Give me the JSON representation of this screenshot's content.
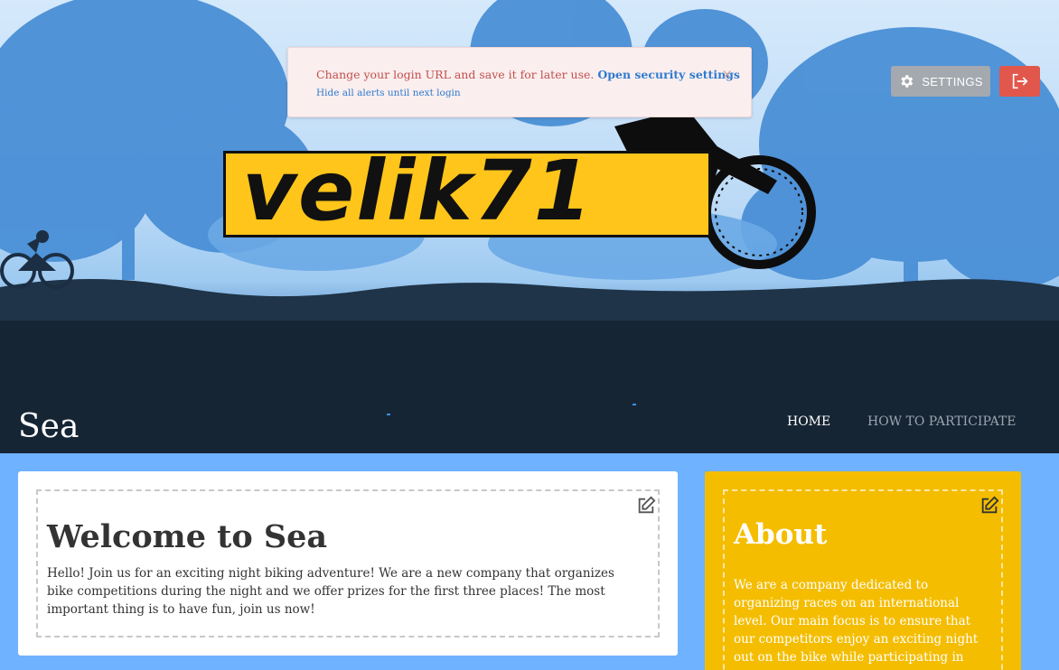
{
  "alert": {
    "message": "Change your login URL and save it for later use.",
    "link": "Open security settings",
    "hide": "Hide all alerts until next login",
    "close": "×"
  },
  "toolbar": {
    "settings_label": "SETTINGS"
  },
  "logo": {
    "text": "velik71"
  },
  "site": {
    "title": "Sea"
  },
  "nav": {
    "items": [
      {
        "label": "HOME"
      },
      {
        "label": "HOW TO PARTICIPATE"
      }
    ]
  },
  "welcome": {
    "title": "Welcome to Sea",
    "text": "Hello! Join us for an exciting night biking adventure! We are a new company that organizes bike competitions during the night and we offer prizes for the first three places! The most important thing is to have fun, join us now!"
  },
  "about": {
    "title": "About",
    "text": "We are a company dedicated to organizing races on an international level. Our main focus is to ensure that our competitors enjoy an exciting night out on the bike while participating in"
  },
  "colors": {
    "accent_blue": "#2e7bcf",
    "about_bg": "#f4bd00",
    "logout_red": "#e2574c",
    "page_bg": "#6fb2ff"
  }
}
